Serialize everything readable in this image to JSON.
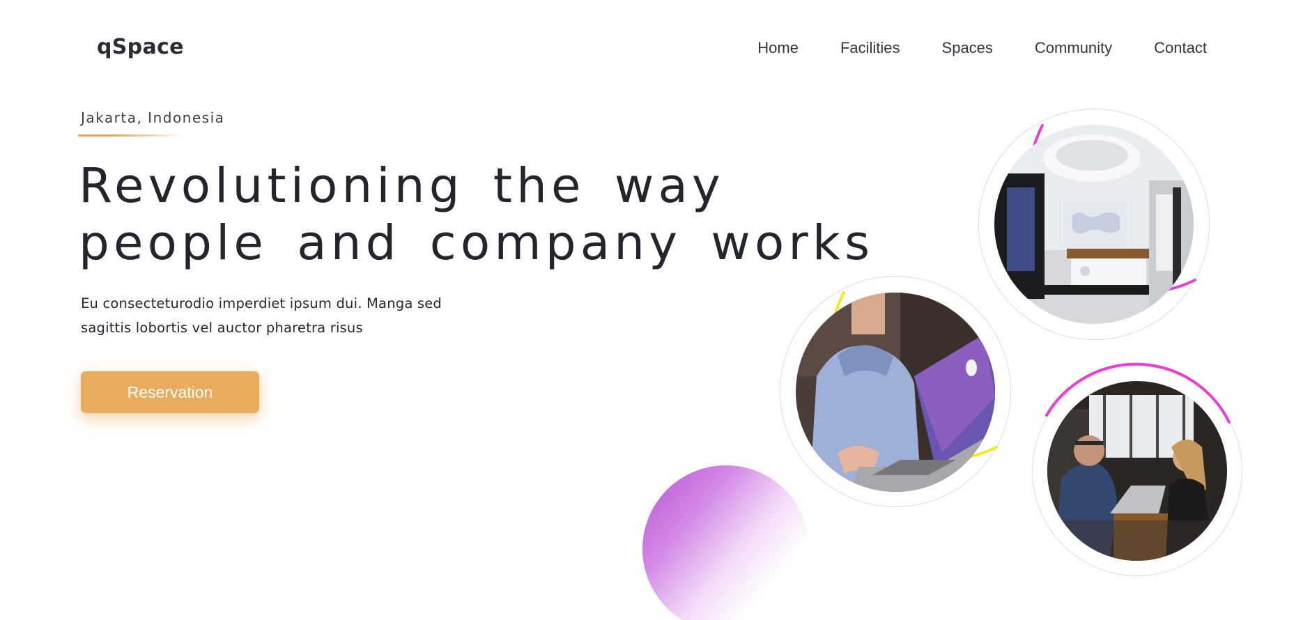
{
  "brand": {
    "name": "qSpace"
  },
  "nav": {
    "items": [
      {
        "label": "Home"
      },
      {
        "label": "Facilities"
      },
      {
        "label": "Spaces"
      },
      {
        "label": "Community"
      },
      {
        "label": "Contact"
      }
    ]
  },
  "hero": {
    "location": "Jakarta, Indonesia",
    "headline_line1": "Revolutioning the way",
    "headline_line2": "people and company works",
    "lead_line1": "Eu consecteturodio imperdiet ipsum dui. Manga sed",
    "lead_line2": "sagittis lobortis vel auctor pharetra risus",
    "cta_label": "Reservation"
  },
  "gallery": {
    "photos": [
      {
        "name": "office-lobby-photo",
        "ring_color": "#e63fd6"
      },
      {
        "name": "man-with-laptop-photo",
        "ring_color": "#f2ec1f"
      },
      {
        "name": "meeting-photo",
        "ring_color": "#e63fd6"
      }
    ]
  },
  "colors": {
    "accent": "#eaab5c",
    "text": "#22252c",
    "magenta": "#e63fd6",
    "yellow": "#f2ec1f",
    "purple": "#b94fd4"
  }
}
